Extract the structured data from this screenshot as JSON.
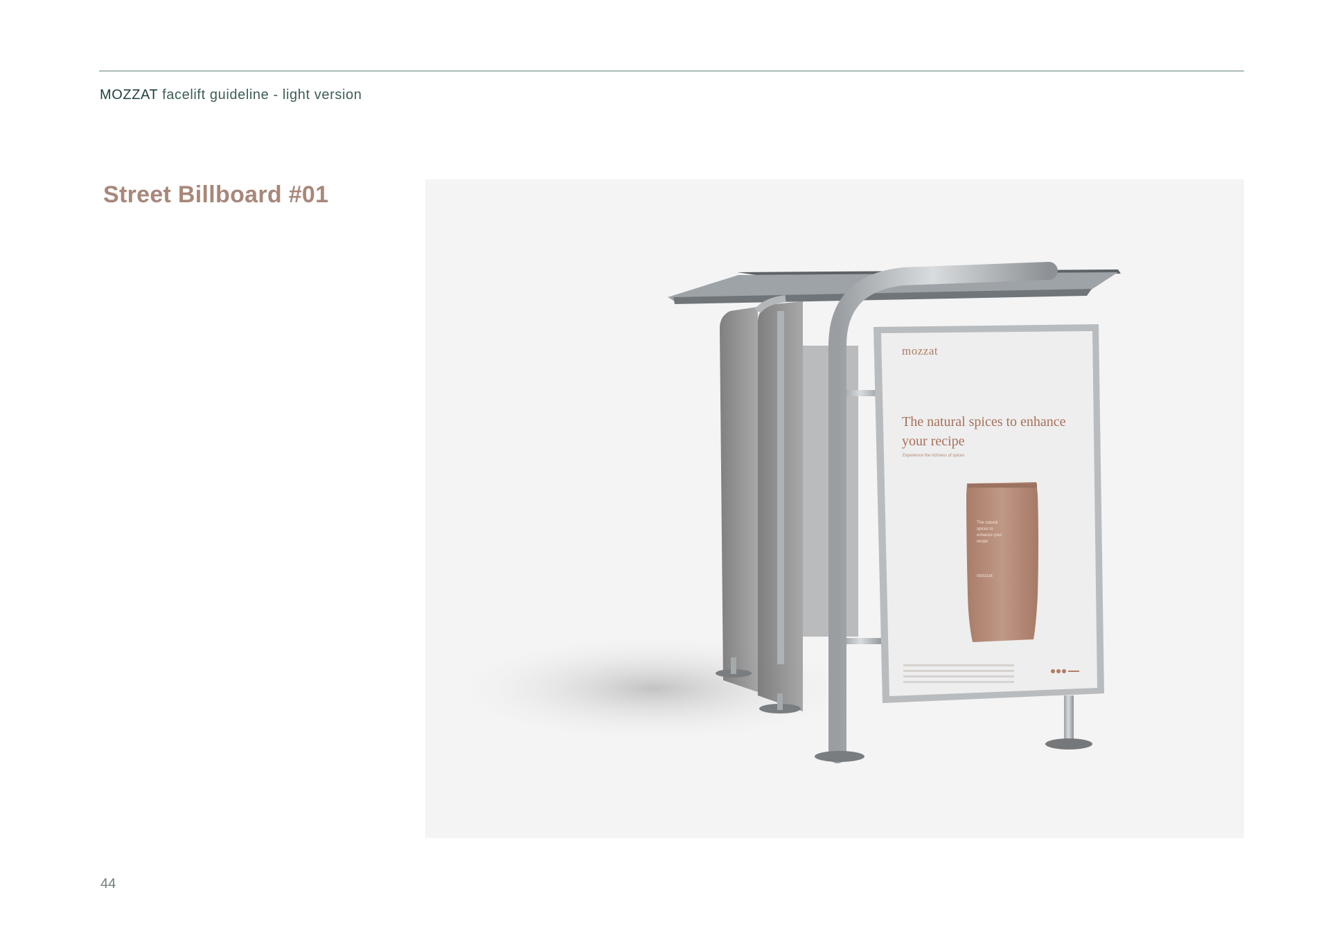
{
  "header": {
    "brand": "MOZZAT",
    "subtitle": " facelift guideline - light version"
  },
  "page": {
    "title": "Street Billboard #01",
    "number": "44"
  },
  "mockup": {
    "poster_brand": "mozzat",
    "poster_headline": "The natural spices to enhance your recipe",
    "poster_subline": "Experience the richness of spices",
    "pouch_text": "The natural spices to enhance your recipe",
    "pouch_brand": "mozzat"
  },
  "colors": {
    "accent": "#a88779",
    "header_text": "#3e5c58",
    "rule": "#5f7f7a",
    "pouch": "#b8917f"
  }
}
